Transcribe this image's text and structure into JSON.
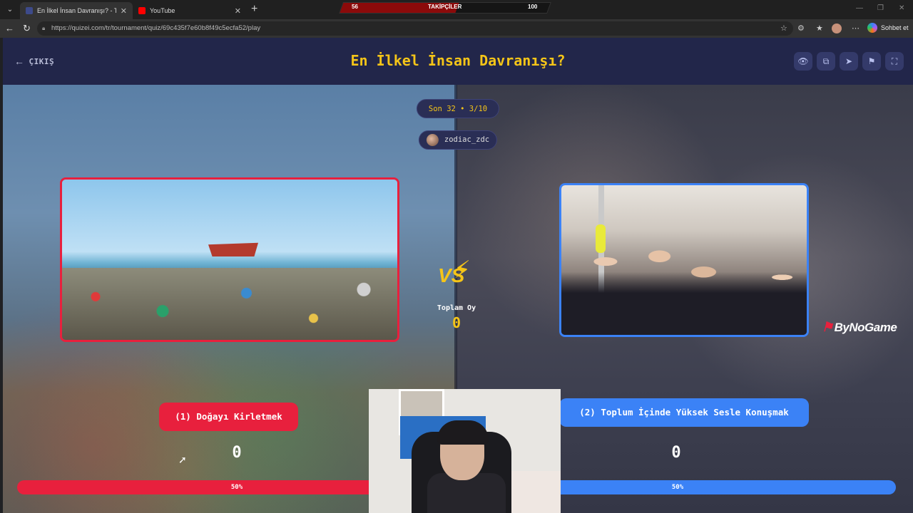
{
  "browser": {
    "tabs": [
      {
        "label": "En İlkel İnsan Davranışı? - Tier List",
        "active": true
      },
      {
        "label": "YouTube",
        "active": false
      }
    ],
    "url": "https://quizei.com/tr/tournament/quiz/69c435f7e60b8f49c5ecfa52/play",
    "copilot_label": "Sohbet et"
  },
  "stream_overlay": {
    "left_value": "56",
    "label": "TAKİPÇİLER",
    "right_value": "100",
    "progress": 0.56
  },
  "header": {
    "exit_label": "ÇIKIŞ",
    "title": "En İlkel İnsan Davranışı?",
    "icons": [
      "eye-icon",
      "share-icon",
      "send-icon",
      "flag-icon",
      "fullscreen-icon"
    ]
  },
  "round": {
    "label": "Son 32 • 3/10",
    "username": "zodiac_zdc"
  },
  "options": {
    "left": {
      "label": "(1) Doğayı Kirletmek",
      "votes": "0",
      "percent": "50%",
      "color": "#e8203d"
    },
    "right": {
      "label": "(2) Toplum İçinde Yüksek Sesle Konuşmak",
      "votes": "0",
      "percent": "50%",
      "color": "#3b82f6"
    }
  },
  "total": {
    "label": "Toplam Oy",
    "value": "0"
  },
  "brand": "ByNoGame",
  "colors": {
    "accent": "#f5c518",
    "background": "#22264a"
  }
}
